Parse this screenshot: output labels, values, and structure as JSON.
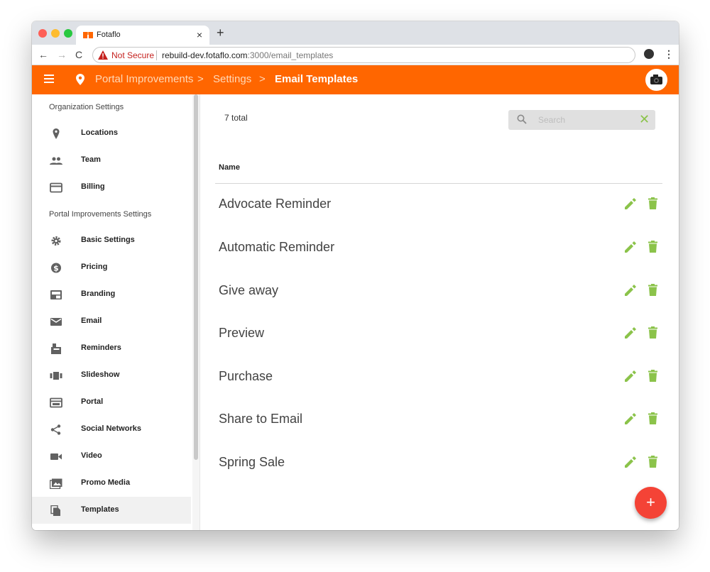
{
  "browser": {
    "tab_title": "Fotaflo",
    "tab_close": "×",
    "new_tab": "+",
    "not_secure": "Not Secure",
    "url_host": "rebuild-dev.fotaflo.com",
    "url_rest": ":3000/email_templates",
    "back": "←",
    "forward": "→",
    "reload": "C",
    "star": "☆",
    "menu": "⋮"
  },
  "appbar": {
    "breadcrumb": [
      "Portal Improvements",
      "Settings",
      "Email Templates"
    ],
    "separator": ">"
  },
  "sidebar": {
    "org_heading": "Organization Settings",
    "org_items": [
      {
        "label": "Locations",
        "icon": "location-pin-icon"
      },
      {
        "label": "Team",
        "icon": "people-icon"
      },
      {
        "label": "Billing",
        "icon": "credit-card-icon"
      }
    ],
    "portal_heading": "Portal Improvements Settings",
    "portal_items": [
      {
        "label": "Basic Settings",
        "icon": "gear-icon"
      },
      {
        "label": "Pricing",
        "icon": "dollar-icon"
      },
      {
        "label": "Branding",
        "icon": "branding-icon"
      },
      {
        "label": "Email",
        "icon": "envelope-icon"
      },
      {
        "label": "Reminders",
        "icon": "mailbox-icon"
      },
      {
        "label": "Slideshow",
        "icon": "slideshow-icon"
      },
      {
        "label": "Portal",
        "icon": "portal-icon"
      },
      {
        "label": "Social Networks",
        "icon": "share-icon"
      },
      {
        "label": "Video",
        "icon": "video-camera-icon"
      },
      {
        "label": "Promo Media",
        "icon": "photo-library-icon"
      },
      {
        "label": "Templates",
        "icon": "copy-icon",
        "active": true
      }
    ]
  },
  "main": {
    "total": "7 total",
    "search_placeholder": "Search",
    "search_clear": "✕",
    "column_name": "Name",
    "rows": [
      "Advocate Reminder",
      "Automatic Reminder",
      "Give away",
      "Preview",
      "Purchase",
      "Share to Email",
      "Spring Sale"
    ],
    "fab_label": "+"
  },
  "colors": {
    "appbar": "#ff6600",
    "action_green": "#8bc34a",
    "fab_red": "#f44336"
  }
}
